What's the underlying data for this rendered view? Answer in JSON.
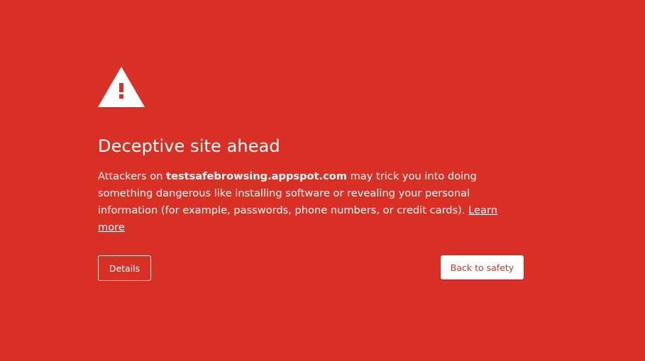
{
  "colors": {
    "background": "#d93025",
    "text": "#ffffff",
    "button_text_primary": "#d93025"
  },
  "icon": "warning-triangle-icon",
  "interstitial": {
    "title": "Deceptive site ahead",
    "message_prefix": "Attackers on ",
    "domain": "testsafebrowsing.appspot.com",
    "message_suffix": " may trick you into doing something dangerous like installing software or revealing your personal information (for example, passwords, phone numbers, or credit cards). ",
    "learn_more_label": "Learn more"
  },
  "buttons": {
    "details_label": "Details",
    "back_to_safety_label": "Back to safety"
  }
}
